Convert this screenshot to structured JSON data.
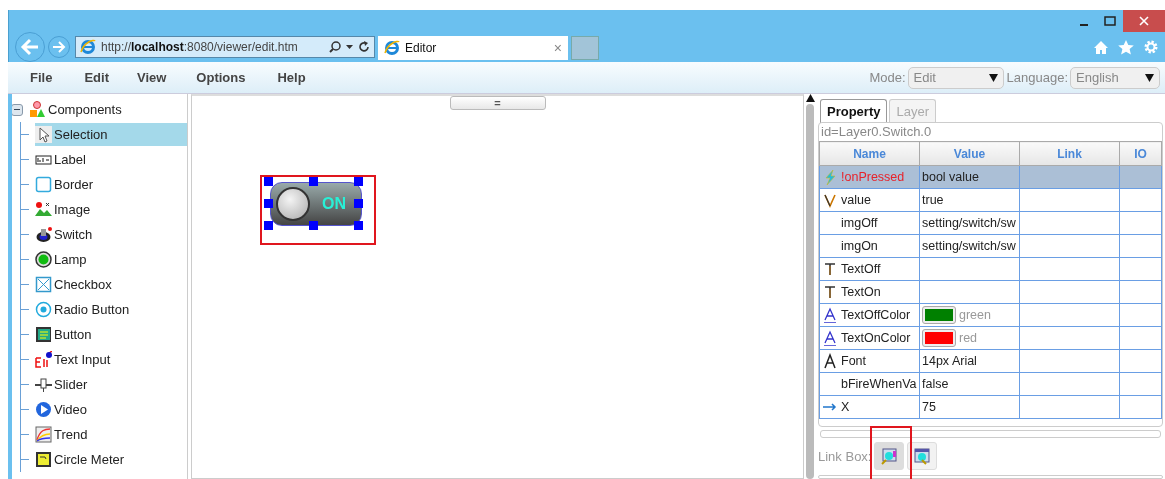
{
  "browser": {
    "address": "http://**localhost**:8080/viewer/edit.htm",
    "tab": {
      "title": "Editor",
      "close": "×"
    }
  },
  "menu": [
    "File",
    "Edit",
    "View",
    "Options",
    "Help"
  ],
  "mode": {
    "label": "Mode:",
    "value": "Edit"
  },
  "language": {
    "label": "Language:",
    "value": "English"
  },
  "tree": {
    "label": "Components",
    "expanded": true,
    "children": [
      {
        "label": "Selection",
        "kind": "selection",
        "selected": true
      },
      {
        "label": "Label",
        "kind": "label",
        "selected": false
      },
      {
        "label": "Border",
        "kind": "border",
        "selected": false
      },
      {
        "label": "Image",
        "kind": "image",
        "selected": false
      },
      {
        "label": "Switch",
        "kind": "switch",
        "selected": false
      },
      {
        "label": "Lamp",
        "kind": "lamp",
        "selected": false
      },
      {
        "label": "Checkbox",
        "kind": "checkbox",
        "selected": false
      },
      {
        "label": "Radio Button",
        "kind": "radio",
        "selected": false
      },
      {
        "label": "Button",
        "kind": "button",
        "selected": false
      },
      {
        "label": "Text Input",
        "kind": "textinput",
        "selected": false
      },
      {
        "label": "Slider",
        "kind": "slider",
        "selected": false
      },
      {
        "label": "Video",
        "kind": "video",
        "selected": false
      },
      {
        "label": "Trend",
        "kind": "trend",
        "selected": false
      },
      {
        "label": "Circle Meter",
        "kind": "meter",
        "selected": false
      }
    ]
  },
  "canvas": {
    "splitter": "=",
    "widget": {
      "kind": "switch",
      "on": true,
      "label": "ON",
      "selected": true
    }
  },
  "inspector": {
    "tabs": [
      {
        "label": "Property",
        "selected": true
      },
      {
        "label": "Layer",
        "selected": false
      }
    ],
    "object_id": "id=Layer0.Switch.0",
    "columns": [
      "Name",
      "Value",
      "Link",
      "IO"
    ],
    "rows": [
      {
        "kind": "event",
        "name": "!onPressed",
        "value": "bool value",
        "selected": true
      },
      {
        "kind": "variable",
        "name": "value",
        "value": "true",
        "selected": false
      },
      {
        "kind": "plain",
        "name": "imgOff",
        "value": "setting/switch/sw",
        "selected": false
      },
      {
        "kind": "plain",
        "name": "imgOn",
        "value": "setting/switch/sw",
        "selected": false
      },
      {
        "kind": "text",
        "name": "TextOff",
        "selected": false
      },
      {
        "kind": "text",
        "name": "TextOn",
        "selected": false
      },
      {
        "kind": "color",
        "name": "TextOffColor",
        "value": "green",
        "color": "#008000",
        "selected": false
      },
      {
        "kind": "color",
        "name": "TextOnColor",
        "value": "red",
        "color": "#ff0000",
        "selected": false
      },
      {
        "kind": "font",
        "name": "Font",
        "value": "14px Arial",
        "selected": false
      },
      {
        "kind": "plain",
        "name": "bFireWhenVa",
        "value": "false",
        "selected": false
      },
      {
        "kind": "position",
        "name": "X",
        "value": "75",
        "selected": false
      }
    ],
    "link_box": {
      "label": "Link Box:"
    }
  }
}
